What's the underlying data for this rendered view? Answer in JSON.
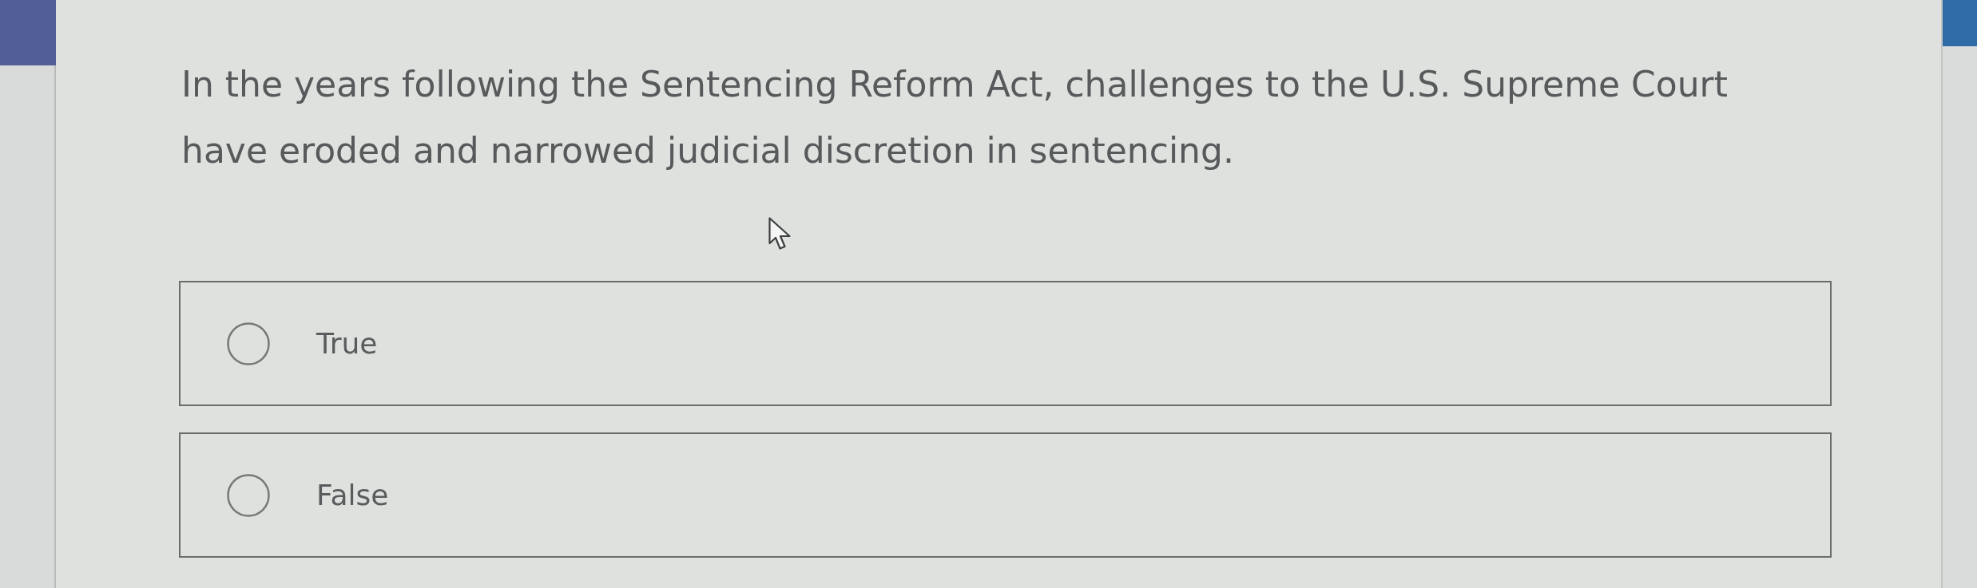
{
  "question": {
    "text": "In the years following the Sentencing Reform Act, challenges to the U.S. Supreme Court have eroded and narrowed judicial discretion in sentencing."
  },
  "options": [
    {
      "label": "True",
      "selected": false
    },
    {
      "label": "False",
      "selected": false
    }
  ]
}
